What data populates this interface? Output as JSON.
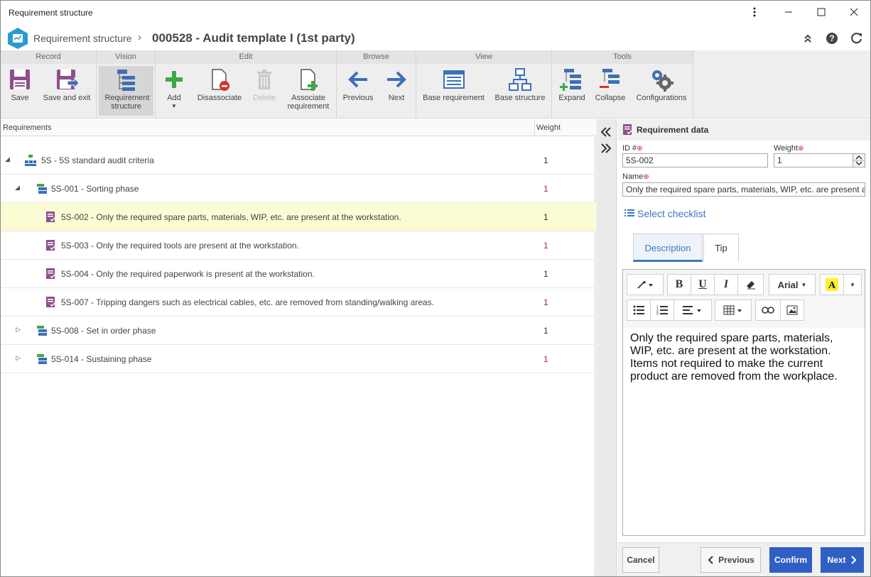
{
  "window": {
    "title": "Requirement structure"
  },
  "header": {
    "crumb": "Requirement structure",
    "title": "000528 - Audit template I (1st party)"
  },
  "ribbon": {
    "groups": [
      {
        "title": "Record",
        "buttons": [
          {
            "label": "Save"
          },
          {
            "label": "Save and exit"
          }
        ]
      },
      {
        "title": "Vision",
        "buttons": [
          {
            "label": "Requirement structure"
          }
        ]
      },
      {
        "title": "Edit",
        "buttons": [
          {
            "label": "Add"
          },
          {
            "label": "Disassociate"
          },
          {
            "label": "Delete"
          },
          {
            "label": "Associate requirement"
          }
        ]
      },
      {
        "title": "Browse",
        "buttons": [
          {
            "label": "Previous"
          },
          {
            "label": "Next"
          }
        ]
      },
      {
        "title": "View",
        "buttons": [
          {
            "label": "Base requirement"
          },
          {
            "label": "Base structure"
          }
        ]
      },
      {
        "title": "Tools",
        "buttons": [
          {
            "label": "Expand"
          },
          {
            "label": "Collapse"
          },
          {
            "label": "Configurations"
          }
        ]
      }
    ]
  },
  "grid": {
    "col_requirements": "Requirements",
    "col_weight": "Weight",
    "rows": [
      {
        "label": "5S - 5S standard audit criteria",
        "weight": "1"
      },
      {
        "label": "5S-001 - Sorting phase",
        "weight": "1"
      },
      {
        "label": "5S-002 - Only the required spare parts, materials, WIP, etc. are present at the workstation.",
        "weight": "1"
      },
      {
        "label": "5S-003 - Only the required tools are present at the workstation.",
        "weight": "1"
      },
      {
        "label": "5S-004 - Only the required paperwork is present at the workstation.",
        "weight": "1"
      },
      {
        "label": "5S-007 - Tripping dangers such as electrical cables, etc. are removed from standing/walking areas.",
        "weight": "1"
      },
      {
        "label": "5S-008 - Set in order phase",
        "weight": "1"
      },
      {
        "label": "5S-014 - Sustaining phase",
        "weight": "1"
      }
    ]
  },
  "panel": {
    "title": "Requirement data",
    "id_label": "ID #",
    "id_value": "5S-002",
    "weight_label": "Weight",
    "weight_value": "1",
    "name_label": "Name",
    "name_value": "Only the required spare parts, materials, WIP, etc. are present at the workstation.",
    "select_checklist": "Select checklist",
    "tabs": {
      "description": "Description",
      "tip": "Tip"
    },
    "editor": {
      "font": "Arial",
      "text": "Only the required spare parts, materials, WIP, etc. are present at the workstation. Items not required to make the current product are removed from the workplace."
    },
    "footer": {
      "cancel": "Cancel",
      "previous": "Previous",
      "confirm": "Confirm",
      "next": "Next"
    }
  },
  "colors": {
    "accent": "#3a78c2",
    "primary_button": "#2f5fc4",
    "selected_row": "#fbfbd4",
    "weight_red": "#a03030"
  }
}
